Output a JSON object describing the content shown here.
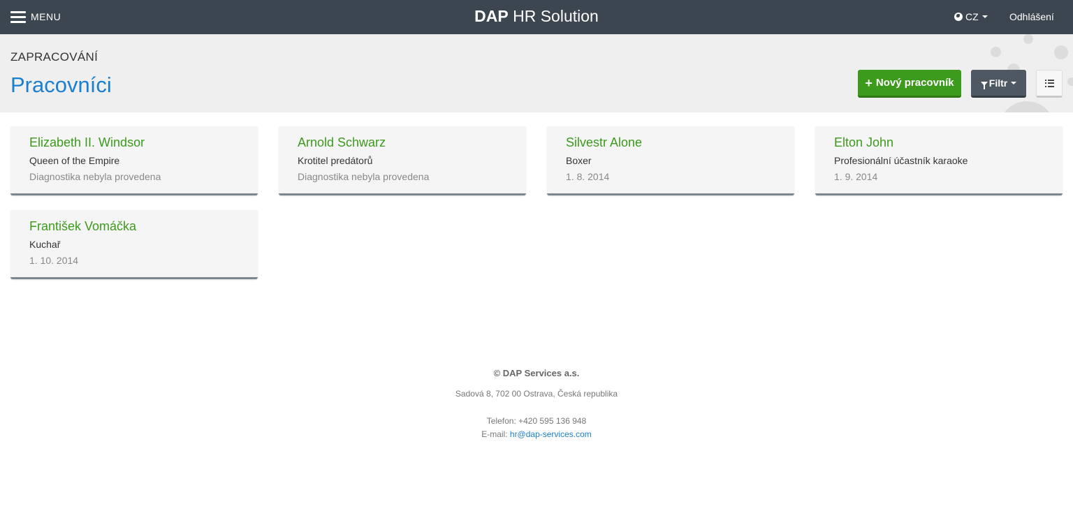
{
  "topbar": {
    "menu_label": "MENU",
    "brand_bold": "DAP",
    "brand_rest": " HR Solution",
    "language": "CZ",
    "logout": "Odhlášení"
  },
  "header": {
    "section": "ZAPRACOVÁNÍ",
    "title": "Pracovníci",
    "new_button": "Nový pracovník",
    "filter_button": "Filtr"
  },
  "employees": [
    {
      "name": "Elizabeth II. Windsor",
      "role": "Queen of the Empire",
      "status": "Diagnostika nebyla provedena"
    },
    {
      "name": "Arnold Schwarz",
      "role": "Krotitel predátorů",
      "status": "Diagnostika nebyla provedena"
    },
    {
      "name": "Silvestr Alone",
      "role": "Boxer",
      "status": "1. 8. 2014"
    },
    {
      "name": "Elton John",
      "role": "Profesionální účastník karaoke",
      "status": "1. 9. 2014"
    },
    {
      "name": "František Vomáčka",
      "role": "Kuchař",
      "status": "1. 10. 2014"
    }
  ],
  "footer": {
    "company": "© DAP Services a.s.",
    "address": "Sadová 8, 702 00 Ostrava, Česká republika",
    "phone": "Telefon: +420 595 136 948",
    "email_label": "E-mail: ",
    "email": "hr@dap-services.com"
  },
  "colors": {
    "topbar": "#3b4650",
    "accent_blue": "#1a7fcf",
    "accent_green": "#3c9a1c"
  }
}
